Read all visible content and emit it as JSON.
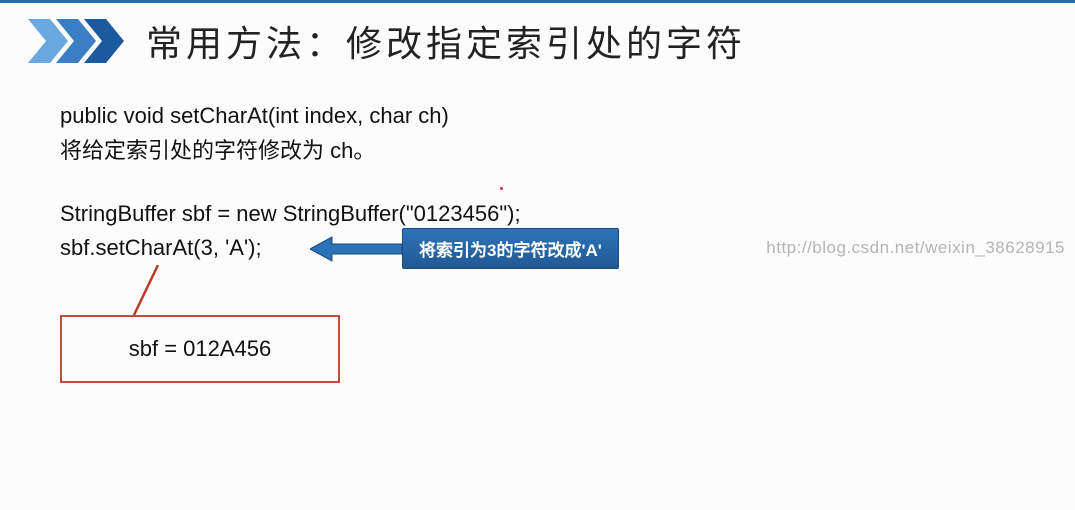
{
  "header": {
    "title": "常用方法：修改指定索引处的字符"
  },
  "body": {
    "signature": "public void setCharAt(int index, char ch)",
    "desc": "将给定索引处的字符修改为 ch。",
    "code1": "StringBuffer sbf = new StringBuffer(\"0123456\");",
    "code2": "sbf.setCharAt(3, 'A');"
  },
  "callout": {
    "text": "将索引为3的字符改成'A'"
  },
  "result": {
    "text": "sbf = 012A456"
  },
  "watermark": {
    "text": "http://blog.csdn.net/weixin_38628915"
  },
  "colors": {
    "topbar": "#1e6fb8",
    "arrow_light": "#6aa8e0",
    "arrow_mid": "#3a7fc4",
    "arrow_dark": "#1a5a9e",
    "callout": "#2c72b8",
    "result_border": "#c24a3a",
    "connector": "#b83a2a"
  }
}
